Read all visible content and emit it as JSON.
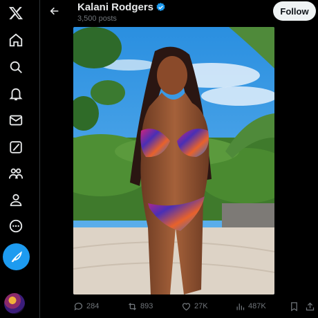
{
  "profile": {
    "name": "Kalani Rodgers",
    "post_count": "3,500 posts",
    "follow_label": "Follow"
  },
  "sidebar": {
    "items": [
      {
        "icon": "x-logo-icon"
      },
      {
        "icon": "home-icon"
      },
      {
        "icon": "search-icon"
      },
      {
        "icon": "notifications-icon"
      },
      {
        "icon": "messages-icon"
      },
      {
        "icon": "grok-icon"
      },
      {
        "icon": "communities-icon"
      },
      {
        "icon": "profile-icon"
      },
      {
        "icon": "more-icon"
      }
    ],
    "compose_icon": "feather-icon"
  },
  "media": {
    "description_icon": "photo"
  },
  "actions": {
    "replies": "284",
    "reposts": "893",
    "likes": "27K",
    "views": "487K"
  },
  "colors": {
    "background": "#000000",
    "accent": "#1d9bf0",
    "muted": "#71767b",
    "text": "#e7e9ea"
  }
}
